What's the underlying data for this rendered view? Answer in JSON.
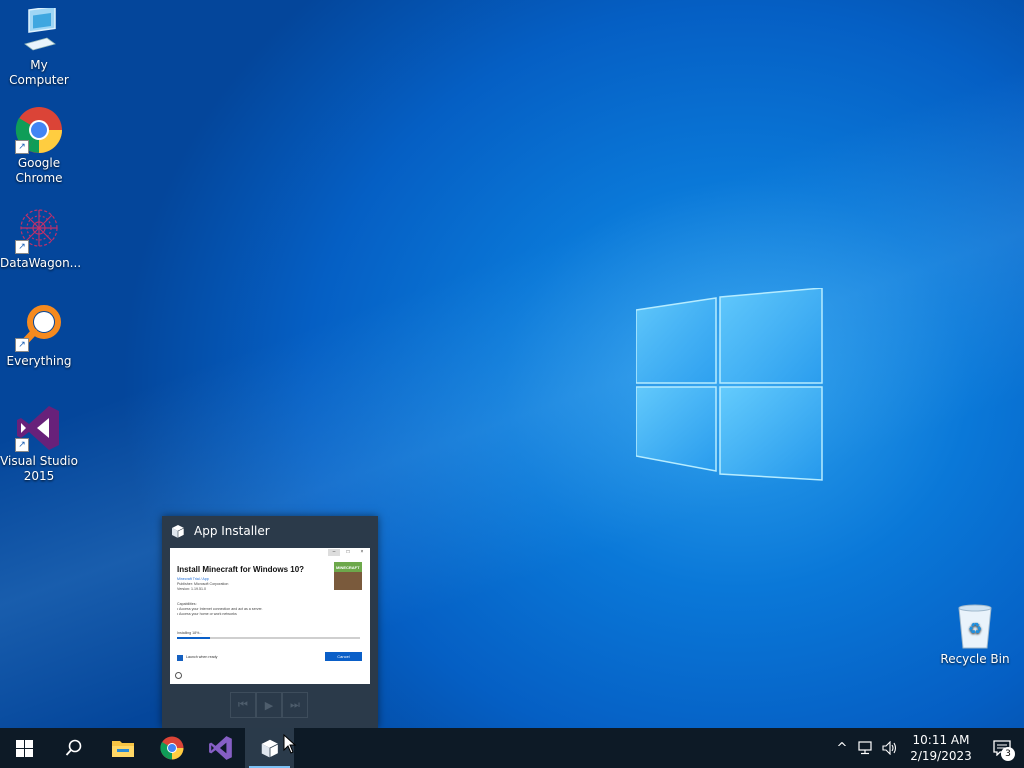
{
  "desktop": {
    "icons": [
      {
        "label": "My Computer",
        "icon": "monitor-icon"
      },
      {
        "label": "Google Chrome",
        "icon": "chrome-icon"
      },
      {
        "label": "DataWagon...",
        "icon": "datawagon-icon"
      },
      {
        "label": "Everything",
        "icon": "magnifier-icon"
      },
      {
        "label": "Visual Studio 2015",
        "icon": "visual-studio-icon"
      },
      {
        "label": "Recycle Bin",
        "icon": "recycle-bin-icon"
      }
    ]
  },
  "preview": {
    "title": "App Installer",
    "window_buttons": [
      "–",
      "□",
      "×"
    ],
    "heading": "Install Minecraft for Windows 10?",
    "publisher_link": "Minecraft Trial / App",
    "publisher": "Publisher: Microsoft Corporation",
    "version": "Version: 1.19.51.0",
    "capabilities_title": "Capabilities:",
    "capability_1": "• Access your Internet connection and act as a server.",
    "capability_2": "• Access your home or work networks",
    "progress_label": "Installing 18%...",
    "progress": 0.18,
    "launch_label": "Launch when ready",
    "cancel_label": "Cancel",
    "tile_label": "MINECRAFT",
    "media": [
      "prev",
      "play",
      "next"
    ]
  },
  "taskbar": {
    "items": [
      "start",
      "search",
      "file-explorer",
      "chrome",
      "visual-studio",
      "app-installer"
    ],
    "active": "app-installer",
    "tray": {
      "chevron": "^",
      "time": "10:11 AM",
      "date": "2/19/2023",
      "notification_count": "3"
    }
  },
  "colors": {
    "taskbar_bg": "#0d1a26",
    "accent": "#0a5fc8",
    "preview_bg": "#2b3a4a"
  }
}
